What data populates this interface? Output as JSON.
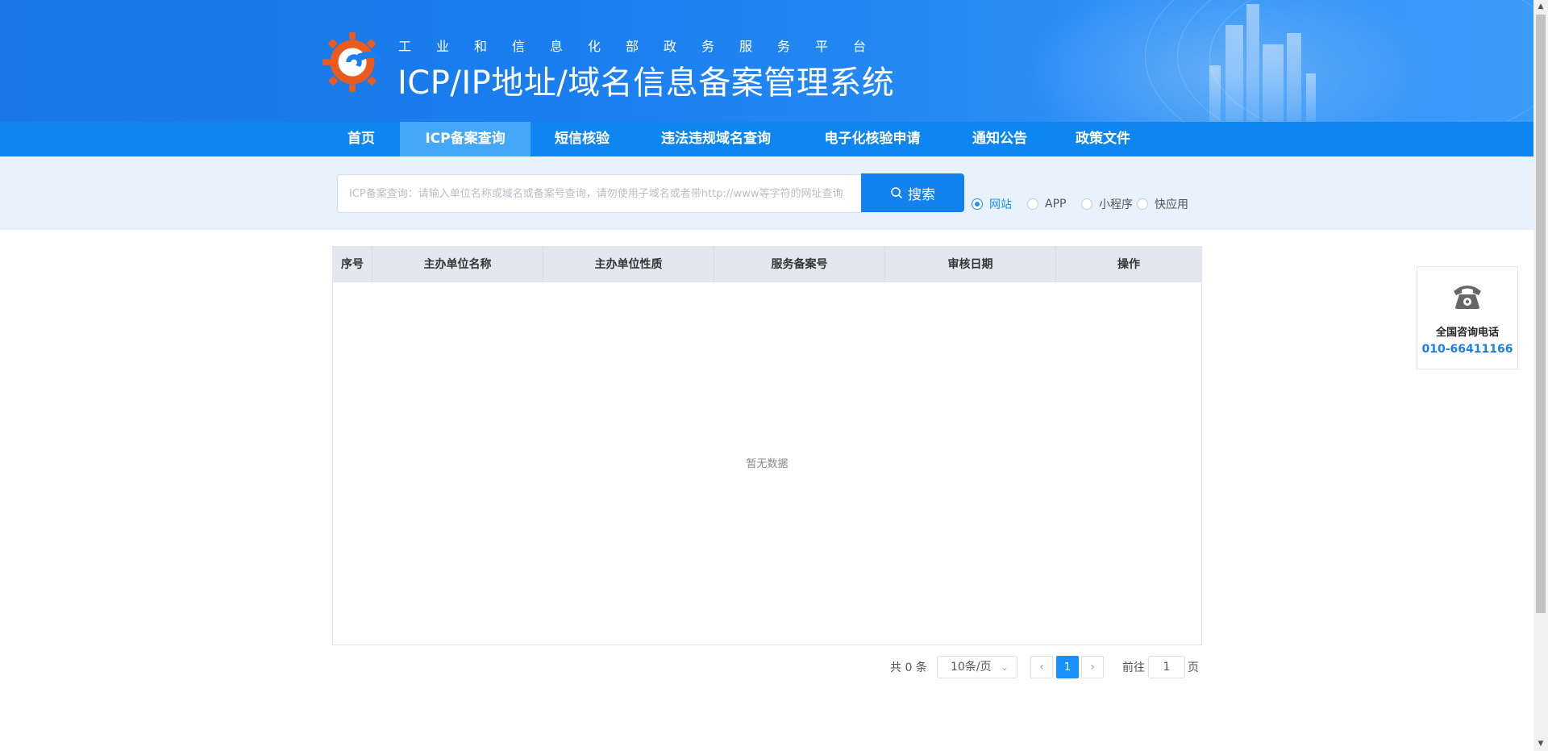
{
  "header": {
    "subtitle": "工业和信息化部政务服务平台",
    "title": "ICP/IP地址/域名信息备案管理系统"
  },
  "nav": {
    "items": [
      {
        "label": "首页"
      },
      {
        "label": "ICP备案查询",
        "active": true
      },
      {
        "label": "短信核验"
      },
      {
        "label": "违法违规域名查询"
      },
      {
        "label": "电子化核验申请"
      },
      {
        "label": "通知公告"
      },
      {
        "label": "政策文件"
      }
    ]
  },
  "search": {
    "placeholder": "ICP备案查询：请输入单位名称或域名或备案号查询，请勿使用子域名或者带http://www等字符的网址查询",
    "button_label": "搜索",
    "types": [
      {
        "label": "网站",
        "checked": true
      },
      {
        "label": "APP"
      },
      {
        "label": "小程序"
      },
      {
        "label": "快应用"
      }
    ]
  },
  "table": {
    "columns": [
      "序号",
      "主办单位名称",
      "主办单位性质",
      "服务备案号",
      "审核日期",
      "操作"
    ],
    "rows": [],
    "empty_text": "暂无数据"
  },
  "pagination": {
    "total_text": "共 0 条",
    "page_size": "10条/页",
    "current_page": "1",
    "goto_label": "前往",
    "goto_value": "1",
    "goto_suffix": "页"
  },
  "consult": {
    "label": "全国咨询电话",
    "phone": "010-66411166"
  },
  "colors": {
    "nav_bg": "#0d86f2",
    "nav_active": "#45a7f7",
    "accent": "#1890ff",
    "search_button": "#1382ee"
  }
}
